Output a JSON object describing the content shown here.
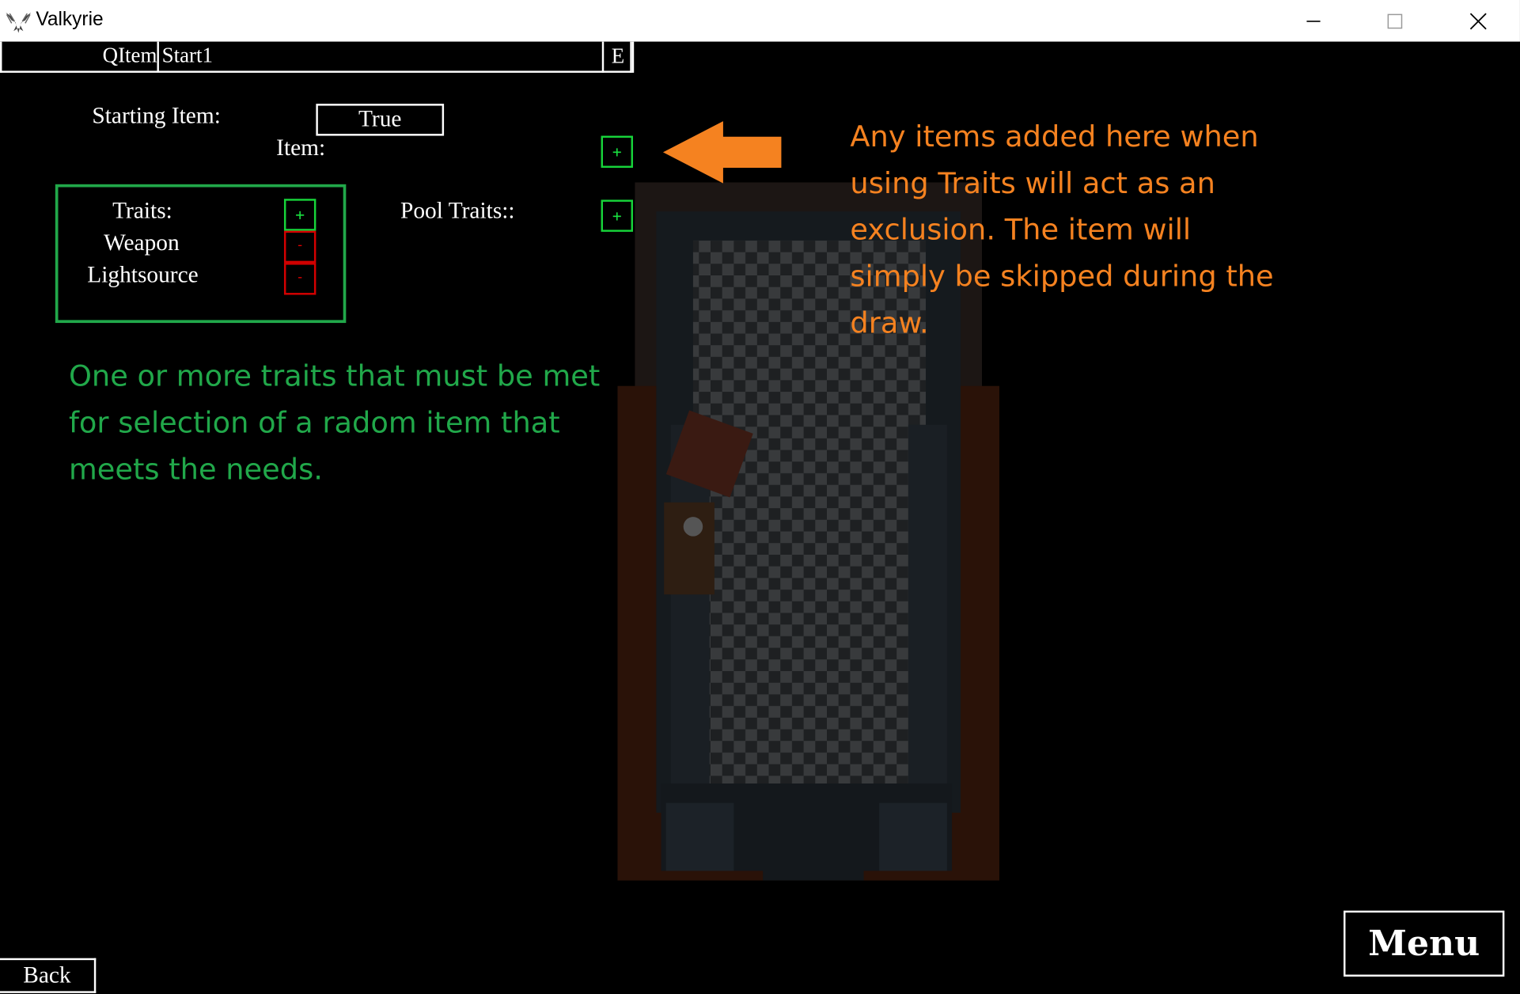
{
  "window": {
    "title": "Valkyrie",
    "minimize_icon": "minimize-icon",
    "maximize_icon": "maximize-icon",
    "close_icon": "close-icon"
  },
  "namebar": {
    "label": "QItem",
    "value": "Start1",
    "edit_label": "E"
  },
  "starting_item": {
    "label": "Starting Item:",
    "value": "True"
  },
  "item": {
    "label": "Item:",
    "add_label": "+"
  },
  "traits": {
    "label": "Traits:",
    "add_label": "+",
    "items": [
      {
        "label": "Weapon",
        "remove_label": "-"
      },
      {
        "label": "Lightsource",
        "remove_label": "-"
      }
    ]
  },
  "pool_traits": {
    "label": "Pool Traits::",
    "add_label": "+"
  },
  "annotations": {
    "green_note": "One or more traits that must be met for selection of a radom item that meets the needs.",
    "orange_note": "Any items added here when using Traits will act as an exclusion. The item will simply be skipped during the draw.",
    "green_color": "#21a84a",
    "orange_color": "#f58220"
  },
  "footer": {
    "back_label": "Back",
    "menu_label": "Menu"
  }
}
